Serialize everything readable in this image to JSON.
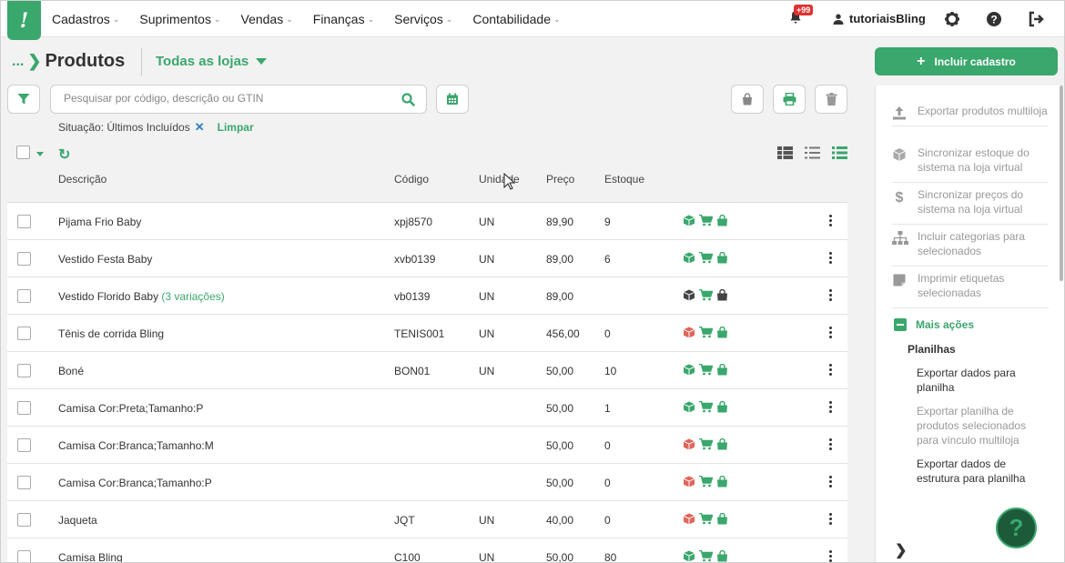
{
  "nav": {
    "logo": "!",
    "menu": [
      "Cadastros",
      "Suprimentos",
      "Vendas",
      "Finanças",
      "Serviços",
      "Contabilidade"
    ],
    "notifications_badge": "+99",
    "user": "tutoriaisBling"
  },
  "header": {
    "breadcrumb_dots": "...",
    "title": "Produtos",
    "store_selector": "Todas as lojas"
  },
  "filters": {
    "search_placeholder": "Pesquisar por código, descrição ou GTIN",
    "situacao": "Situação: Últimos Incluídos",
    "clear": "Limpar"
  },
  "table": {
    "columns": [
      "Descrição",
      "Código",
      "Unidade",
      "Preço",
      "Estoque"
    ],
    "rows": [
      {
        "descricao": "Pijama Frio Baby",
        "variacoes": "",
        "codigo": "xpj8570",
        "unidade": "UN",
        "preco": "89,90",
        "estoque": "9",
        "box": "green",
        "cart": "green",
        "bag": "green"
      },
      {
        "descricao": "Vestido Festa Baby",
        "variacoes": "",
        "codigo": "xvb0139",
        "unidade": "UN",
        "preco": "89,00",
        "estoque": "6",
        "box": "green",
        "cart": "green",
        "bag": "green"
      },
      {
        "descricao": "Vestido Florido Baby",
        "variacoes": "(3 variações)",
        "codigo": "vb0139",
        "unidade": "UN",
        "preco": "89,00",
        "estoque": "",
        "box": "dark",
        "cart": "green",
        "bag": "dark"
      },
      {
        "descricao": "Tênis de corrida Bling",
        "variacoes": "",
        "codigo": "TENIS001",
        "unidade": "UN",
        "preco": "456,00",
        "estoque": "0",
        "box": "red",
        "cart": "green",
        "bag": "green"
      },
      {
        "descricao": "Boné",
        "variacoes": "",
        "codigo": "BON01",
        "unidade": "UN",
        "preco": "50,00",
        "estoque": "10",
        "box": "green",
        "cart": "green",
        "bag": "green"
      },
      {
        "descricao": "Camisa Cor:Preta;Tamanho:P",
        "variacoes": "",
        "codigo": "",
        "unidade": "",
        "preco": "50,00",
        "estoque": "1",
        "box": "green",
        "cart": "green",
        "bag": "green"
      },
      {
        "descricao": "Camisa Cor:Branca;Tamanho:M",
        "variacoes": "",
        "codigo": "",
        "unidade": "",
        "preco": "50,00",
        "estoque": "0",
        "box": "red",
        "cart": "green",
        "bag": "green"
      },
      {
        "descricao": "Camisa Cor:Branca;Tamanho:P",
        "variacoes": "",
        "codigo": "",
        "unidade": "",
        "preco": "50,00",
        "estoque": "0",
        "box": "red",
        "cart": "green",
        "bag": "green"
      },
      {
        "descricao": "Jaqueta",
        "variacoes": "",
        "codigo": "JQT",
        "unidade": "UN",
        "preco": "40,00",
        "estoque": "0",
        "box": "red",
        "cart": "green",
        "bag": "green"
      },
      {
        "descricao": "Camisa Bling",
        "variacoes": "",
        "codigo": "C100",
        "unidade": "UN",
        "preco": "50,00",
        "estoque": "80",
        "box": "green",
        "cart": "green",
        "bag": "green"
      }
    ]
  },
  "sidebar": {
    "primary_button": "Incluir cadastro",
    "actions": [
      "Exportar produtos multiloja",
      "Sincronizar estoque do sistema na loja virtual",
      "Sincronizar preços do sistema na loja virtual",
      "Incluir categorias para selecionados",
      "Imprimir etiquetas selecionadas"
    ],
    "more_actions": "Mais ações",
    "spreadsheets_title": "Planilhas",
    "spreadsheets": [
      {
        "label": "Exportar dados para planilha",
        "enabled": true
      },
      {
        "label": "Exportar planilha de produtos selecionados para vínculo multiloja",
        "enabled": false
      },
      {
        "label": "Exportar dados de estrutura para planilha",
        "enabled": true
      }
    ]
  },
  "help_button": "?",
  "colors": {
    "green": "#3aa76d",
    "red": "#e0665a",
    "dark": "#444444"
  }
}
